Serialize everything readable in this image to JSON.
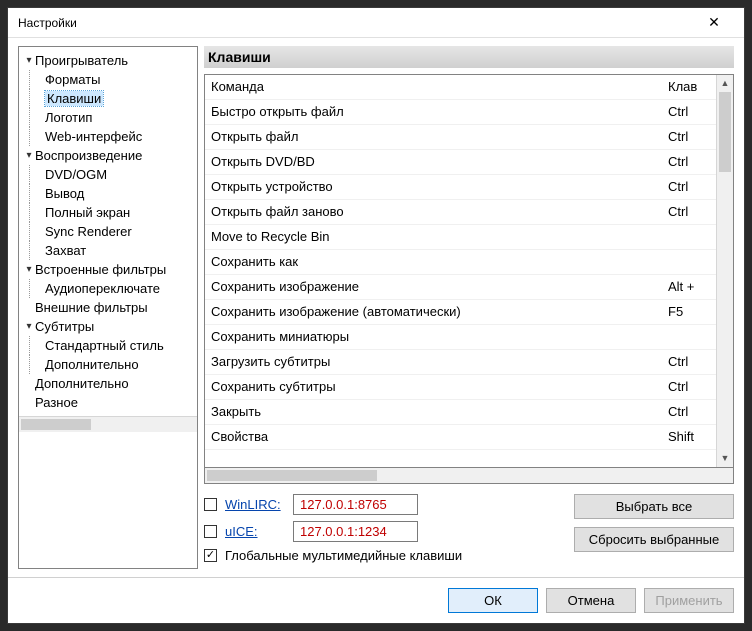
{
  "window": {
    "title": "Настройки"
  },
  "tree": [
    {
      "label": "Проигрыватель",
      "expanded": true,
      "children": [
        {
          "label": "Форматы"
        },
        {
          "label": "Клавиши",
          "selected": true
        },
        {
          "label": "Логотип"
        },
        {
          "label": "Web-интерфейс"
        }
      ]
    },
    {
      "label": "Воспроизведение",
      "expanded": true,
      "children": [
        {
          "label": "DVD/OGM"
        },
        {
          "label": "Вывод"
        },
        {
          "label": "Полный экран"
        },
        {
          "label": "Sync Renderer"
        },
        {
          "label": "Захват"
        }
      ]
    },
    {
      "label": "Встроенные фильтры",
      "expanded": true,
      "children": [
        {
          "label": "Аудиопереключате"
        }
      ]
    },
    {
      "label": "Внешние фильтры",
      "expanded": false,
      "children": []
    },
    {
      "label": "Субтитры",
      "expanded": true,
      "children": [
        {
          "label": "Стандартный стиль"
        },
        {
          "label": "Дополнительно"
        }
      ]
    },
    {
      "label": "Дополнительно",
      "expanded": false,
      "children": []
    },
    {
      "label": "Разное",
      "expanded": false,
      "children": []
    }
  ],
  "section_title": "Клавиши",
  "columns": {
    "command": "Команда",
    "key": "Клав"
  },
  "rows": [
    {
      "command": "Быстро открыть файл",
      "key": "Ctrl"
    },
    {
      "command": "Открыть файл",
      "key": "Ctrl"
    },
    {
      "command": "Открыть DVD/BD",
      "key": "Ctrl"
    },
    {
      "command": "Открыть устройство",
      "key": "Ctrl"
    },
    {
      "command": "Открыть файл заново",
      "key": "Ctrl"
    },
    {
      "command": "Move to Recycle Bin",
      "key": ""
    },
    {
      "command": "Сохранить как",
      "key": ""
    },
    {
      "command": "Сохранить изображение",
      "key": "Alt +"
    },
    {
      "command": "Сохранить изображение (автоматически)",
      "key": "F5"
    },
    {
      "command": "Сохранить миниатюры",
      "key": ""
    },
    {
      "command": "Загрузить субтитры",
      "key": "Ctrl"
    },
    {
      "command": "Сохранить субтитры",
      "key": "Ctrl"
    },
    {
      "command": "Закрыть",
      "key": "Ctrl"
    },
    {
      "command": "Свойства",
      "key": "Shift"
    }
  ],
  "remote": {
    "winlirc": {
      "label": "WinLIRC:",
      "value": "127.0.0.1:8765",
      "checked": false
    },
    "uice": {
      "label": "uICE:",
      "value": "127.0.0.1:1234",
      "checked": false
    },
    "global": {
      "label": "Глобальные мультимедийные клавиши",
      "checked": true
    }
  },
  "buttons": {
    "select_all": "Выбрать все",
    "reset_selected": "Сбросить выбранные",
    "ok": "ОК",
    "cancel": "Отмена",
    "apply": "Применить"
  }
}
